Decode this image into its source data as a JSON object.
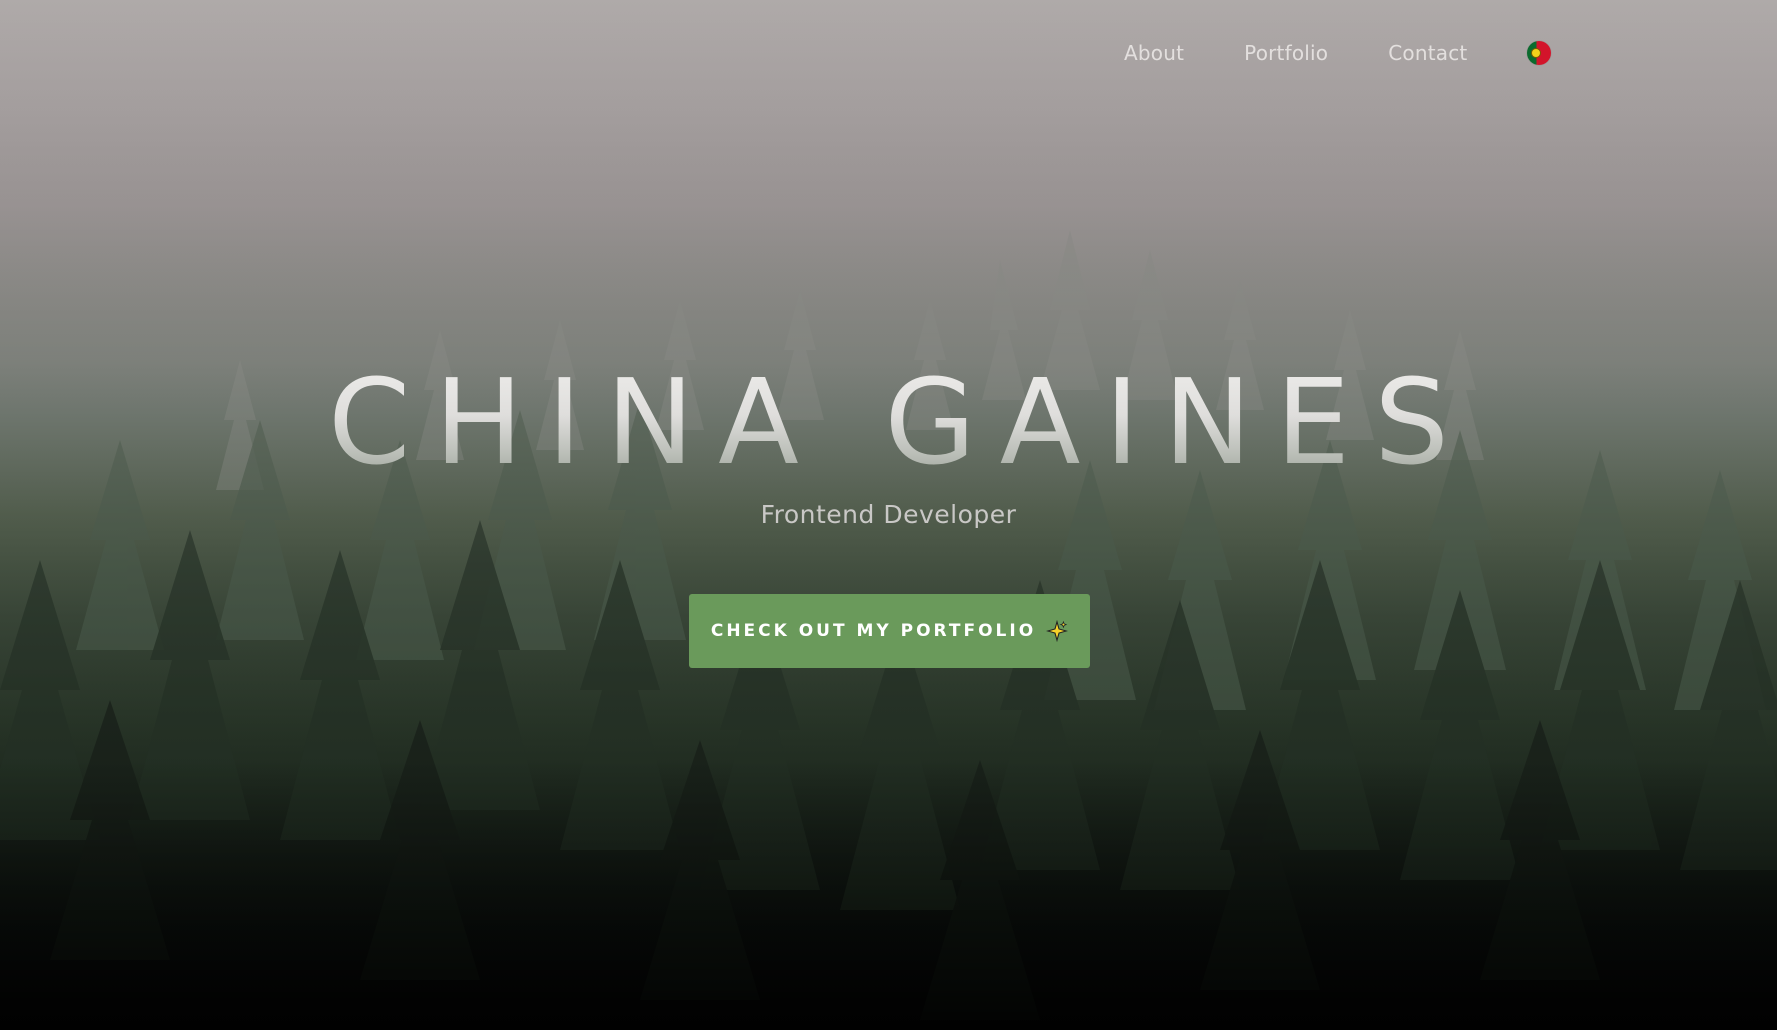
{
  "nav": {
    "links": [
      {
        "label": "About"
      },
      {
        "label": "Portfolio"
      },
      {
        "label": "Contact"
      }
    ],
    "language_icon": "portugal-flag-icon"
  },
  "hero": {
    "title": "CHINA GAINES",
    "subtitle": "Frontend Developer",
    "cta_label": "CHECK OUT MY PORTFOLIO",
    "cta_icon": "sparkle-icon",
    "background": "misty-pine-forest"
  },
  "colors": {
    "cta_background": "#6a9a5b",
    "nav_text": "#e8e5e3",
    "subtitle_text": "#c9c8c6"
  }
}
